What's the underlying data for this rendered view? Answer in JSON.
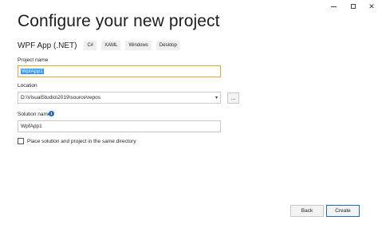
{
  "window": {
    "minimize_glyph": "",
    "close_glyph": "✕"
  },
  "header": {
    "title": "Configure your new project"
  },
  "template": {
    "name": "WPF App (.NET)",
    "tags": [
      "C#",
      "XAML",
      "Windows",
      "Desktop"
    ]
  },
  "form": {
    "project_name_label": "Project name",
    "project_name_value": "WpfApp1",
    "location_label": "Location",
    "location_value": "D:\\VisualStudio\\2019\\source\\repos",
    "browse_label": "...",
    "solution_name_label": "Solution name",
    "solution_name_value": "WpfApp1",
    "info_glyph": "i",
    "same_directory_label": "Place solution and project in the same directory",
    "same_directory_checked": false
  },
  "footer": {
    "back_label": "Back",
    "create_label": "Create"
  },
  "colors": {
    "accent": "#1b6ec2",
    "focus_border": "#e0a830",
    "selection": "#3399ff"
  },
  "icons": {
    "minimize": "minimize-icon",
    "maximize": "maximize-icon",
    "close": "close-icon",
    "dropdown": "chevron-down-icon",
    "info": "info-icon"
  }
}
